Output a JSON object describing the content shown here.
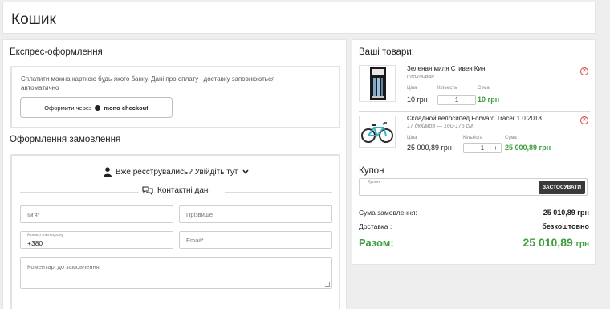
{
  "page": {
    "title": "Кошик"
  },
  "express": {
    "title": "Експрес-оформлення",
    "description": "Сплатити можна карткою будь-якого банку. Дані про оплату і доставку заповнюються автоматично",
    "button_prefix": "Оформити через",
    "button_brand": "mono checkout"
  },
  "order": {
    "title": "Оформлення замовлення",
    "login_prompt": "Вже реєструвались? Увійдіть тут",
    "contacts_title": "Контактні дані",
    "fields": {
      "first_name_placeholder": "Ім'я*",
      "last_name_placeholder": "Прізвище",
      "phone_label": "Номер телефону",
      "phone_value": "+380",
      "email_placeholder": "Email*",
      "comment_placeholder": "Коментарі до замовлення"
    }
  },
  "cart": {
    "title": "Ваші товари:",
    "column_labels": {
      "price": "Ціна",
      "qty": "Кількість",
      "sum": "Сума"
    },
    "items": [
      {
        "name": "Зеленая миля Стивен Кинг",
        "subtitle": "тестовая",
        "thumb": "book-cover",
        "price": "10 грн",
        "qty": "1",
        "sum": "10 грн"
      },
      {
        "name": "Складной велосипед Forward Tracer 1.0 2018",
        "subtitle": "17 дюймов — 160-175 см",
        "thumb": "bicycle",
        "price": "25 000,89 грн",
        "qty": "1",
        "sum": "25 000,89 грн"
      }
    ],
    "coupon": {
      "title": "Купон",
      "placeholder": "Купон",
      "apply_label": "ЗАСТОСУВАТИ"
    },
    "totals": {
      "order_sum_label": "Сума замовлення:",
      "order_sum_value": "25 010,89 грн",
      "delivery_label": "Доставка :",
      "delivery_value": "безкоштовно",
      "grand_label": "Разом:",
      "grand_value": "25 010,89",
      "grand_currency": "грн"
    }
  },
  "colors": {
    "accent_green": "#3f9e3f",
    "danger_red": "#d64545",
    "button_dark": "#3a3a3a"
  }
}
